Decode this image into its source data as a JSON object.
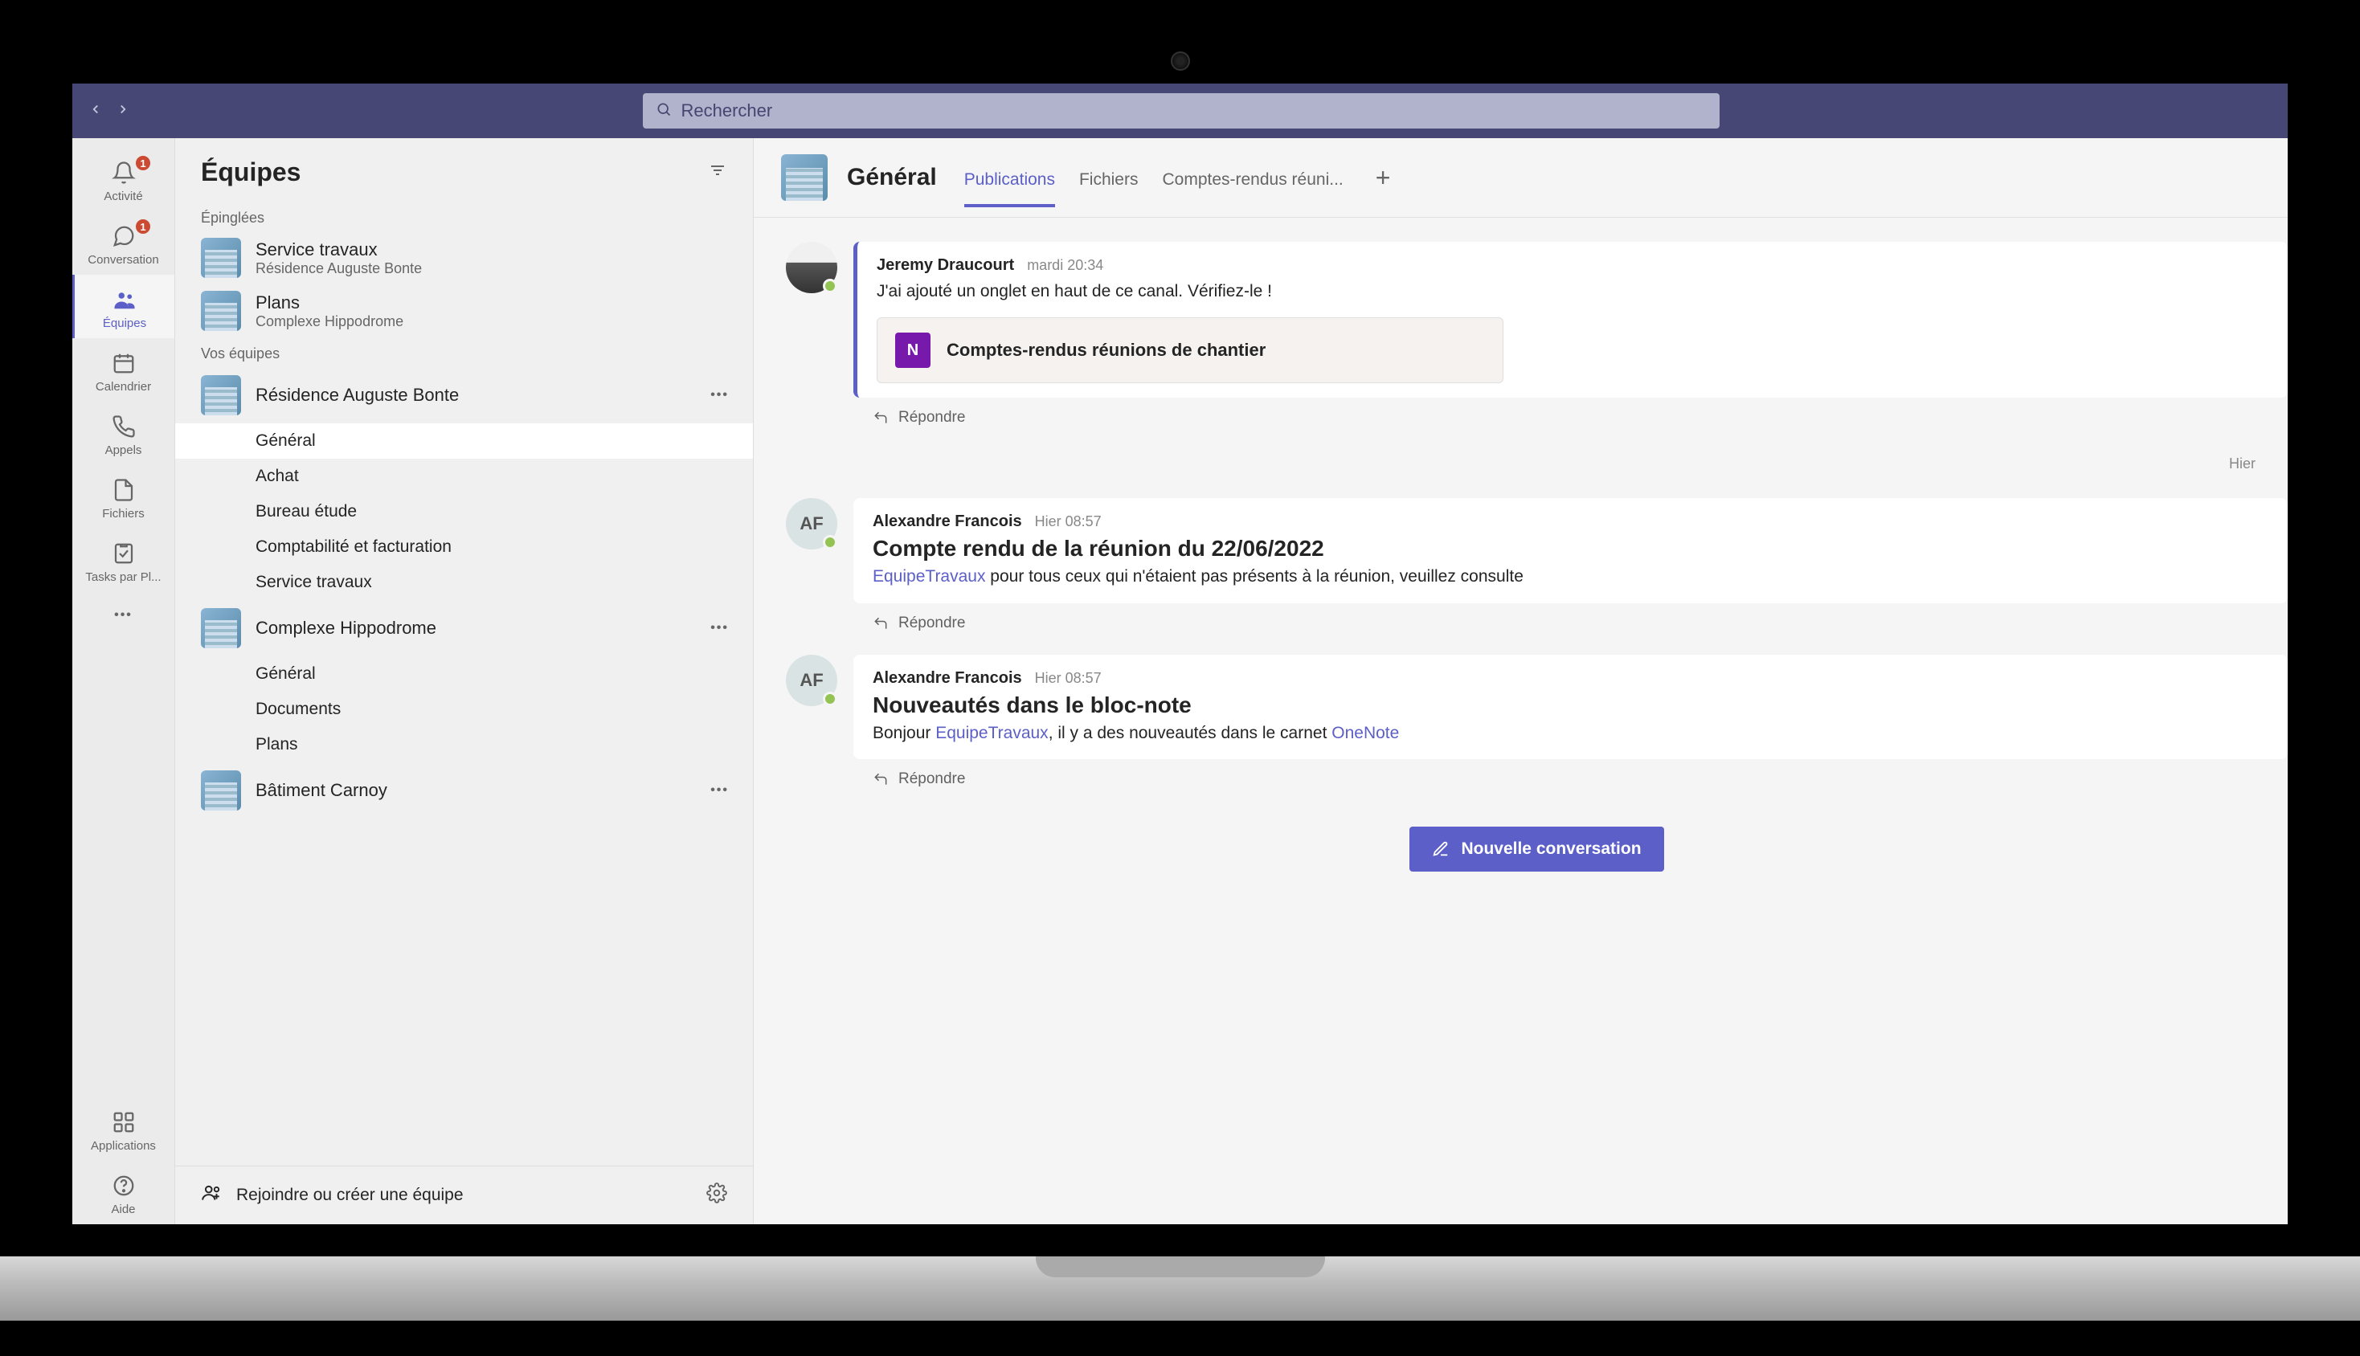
{
  "search": {
    "placeholder": "Rechercher"
  },
  "rail": {
    "items": [
      {
        "label": "Activité",
        "badge": "1"
      },
      {
        "label": "Conversation",
        "badge": "1"
      },
      {
        "label": "Équipes"
      },
      {
        "label": "Calendrier"
      },
      {
        "label": "Appels"
      },
      {
        "label": "Fichiers"
      },
      {
        "label": "Tasks par Pl..."
      }
    ],
    "apps": "Applications",
    "help": "Aide"
  },
  "sidebar": {
    "title": "Équipes",
    "pinned_label": "Épinglées",
    "pinned": [
      {
        "title": "Service travaux",
        "sub": "Résidence Auguste Bonte"
      },
      {
        "title": "Plans",
        "sub": "Complexe Hippodrome"
      }
    ],
    "your_teams_label": "Vos équipes",
    "teams": [
      {
        "name": "Résidence Auguste Bonte",
        "channels": [
          "Général",
          "Achat",
          "Bureau étude",
          "Comptabilité et facturation",
          "Service travaux"
        ]
      },
      {
        "name": "Complexe Hippodrome",
        "channels": [
          "Général",
          "Documents",
          "Plans"
        ]
      },
      {
        "name": "Bâtiment Carnoy"
      }
    ],
    "join": "Rejoindre ou créer une équipe"
  },
  "channel": {
    "title": "Général",
    "tabs": [
      "Publications",
      "Fichiers",
      "Comptes-rendus réuni..."
    ]
  },
  "messages": {
    "date_divider": "Hier",
    "m1": {
      "author": "Jeremy Draucourt",
      "time": "mardi 20:34",
      "body": "J'ai ajouté un onglet en haut de ce canal. Vérifiez-le !",
      "attachment": "Comptes-rendus réunions de chantier"
    },
    "m2": {
      "author": "Alexandre Francois",
      "initials": "AF",
      "time": "Hier 08:57",
      "title": "Compte rendu de la réunion du 22/06/2022",
      "mention": "EquipeTravaux",
      "body_after": " pour tous ceux qui n'étaient pas présents à la réunion, veuillez consulte"
    },
    "m3": {
      "author": "Alexandre Francois",
      "initials": "AF",
      "time": "Hier 08:57",
      "title": "Nouveautés dans le bloc-note",
      "body_before": "Bonjour ",
      "mention": "EquipeTravaux",
      "body_mid": ", il y a des nouveautés dans le carnet ",
      "link": "OneNote"
    },
    "reply": "Répondre",
    "new_convo": "Nouvelle conversation"
  }
}
